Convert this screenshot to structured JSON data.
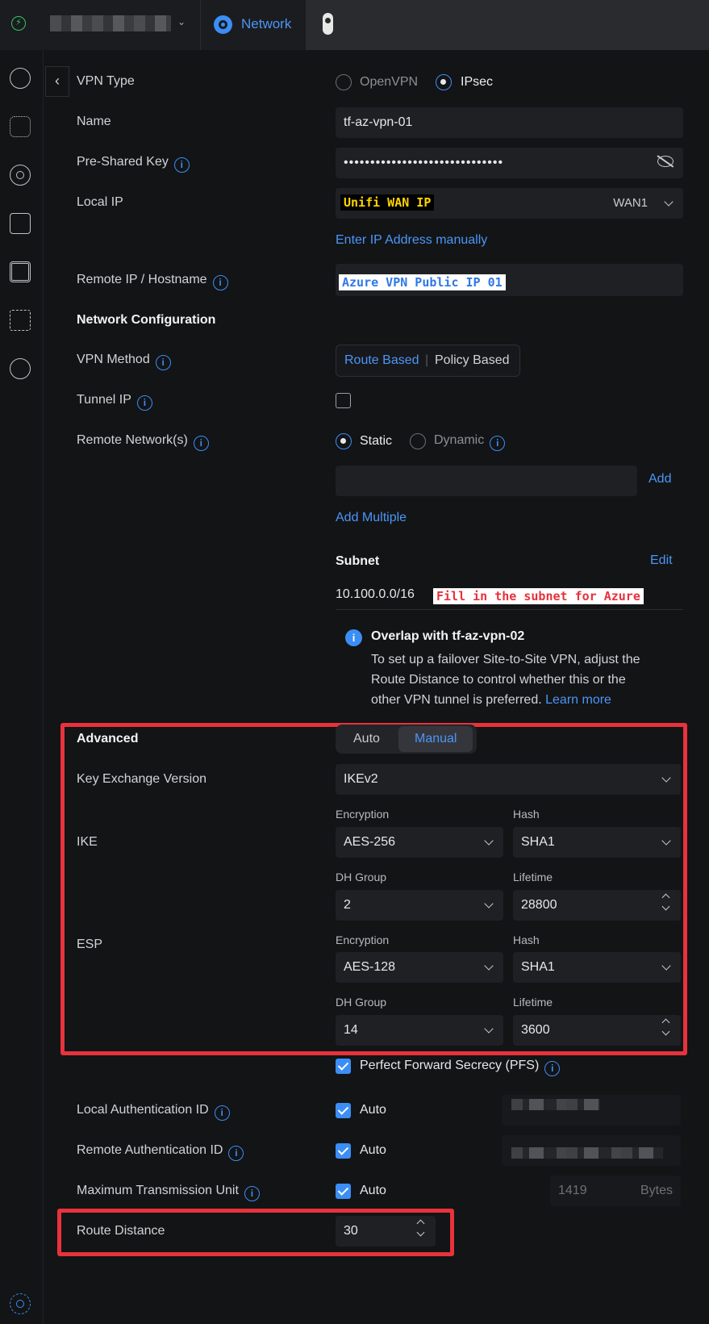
{
  "topbar": {
    "network_label": "Network"
  },
  "vpn_type": {
    "label": "VPN Type",
    "options": [
      "OpenVPN",
      "IPsec"
    ],
    "selected": "IPsec"
  },
  "name": {
    "label": "Name",
    "value": "tf-az-vpn-01"
  },
  "psk": {
    "label": "Pre-Shared Key",
    "value": "••••••••••••••••••••••••••••••"
  },
  "local_ip": {
    "label": "Local IP",
    "tag": "Unifi WAN IP",
    "select": "WAN1",
    "manual_link": "Enter IP Address manually"
  },
  "remote_ip": {
    "label": "Remote IP / Hostname",
    "tag": "Azure VPN Public IP 01"
  },
  "network_config": {
    "heading": "Network Configuration"
  },
  "vpn_method": {
    "label": "VPN Method",
    "options": [
      "Route Based",
      "Policy Based"
    ],
    "selected": "Route Based",
    "sep": "|"
  },
  "tunnel_ip": {
    "label": "Tunnel IP"
  },
  "remote_networks": {
    "label": "Remote Network(s)",
    "options": [
      "Static",
      "Dynamic"
    ],
    "selected": "Static",
    "add": "Add",
    "add_multiple": "Add Multiple",
    "subnet_heading": "Subnet",
    "edit": "Edit",
    "subnet_value": "10.100.0.0/16",
    "subnet_tag": "Fill in the subnet for Azure"
  },
  "notice": {
    "title": "Overlap with tf-az-vpn-02",
    "line1": "To set up a failover Site-to-Site VPN, adjust the",
    "line2": "Route Distance to control whether this or the",
    "line3": "other VPN tunnel is preferred.",
    "link": "Learn more"
  },
  "advanced": {
    "label": "Advanced",
    "modes": [
      "Auto",
      "Manual"
    ],
    "selected": "Manual",
    "kex_label": "Key Exchange Version",
    "kex_value": "IKEv2",
    "ike": {
      "label": "IKE",
      "enc_label": "Encryption",
      "enc": "AES-256",
      "hash_label": "Hash",
      "hash": "SHA1",
      "dh_label": "DH Group",
      "dh": "2",
      "life_label": "Lifetime",
      "life": "28800"
    },
    "esp": {
      "label": "ESP",
      "enc_label": "Encryption",
      "enc": "AES-128",
      "hash_label": "Hash",
      "hash": "SHA1",
      "dh_label": "DH Group",
      "dh": "14",
      "life_label": "Lifetime",
      "life": "3600"
    },
    "pfs": "Perfect Forward Secrecy (PFS)"
  },
  "local_auth": {
    "label": "Local Authentication ID",
    "check": "Auto"
  },
  "remote_auth": {
    "label": "Remote Authentication ID",
    "check": "Auto"
  },
  "mtu": {
    "label": "Maximum Transmission Unit",
    "check": "Auto",
    "placeholder": "1419",
    "unit": "Bytes"
  },
  "route_distance": {
    "label": "Route Distance",
    "value": "30"
  },
  "colors": {
    "accent": "#3b8ef5",
    "highlight": "#e8323c",
    "tag_yellow": "#ffd400"
  }
}
